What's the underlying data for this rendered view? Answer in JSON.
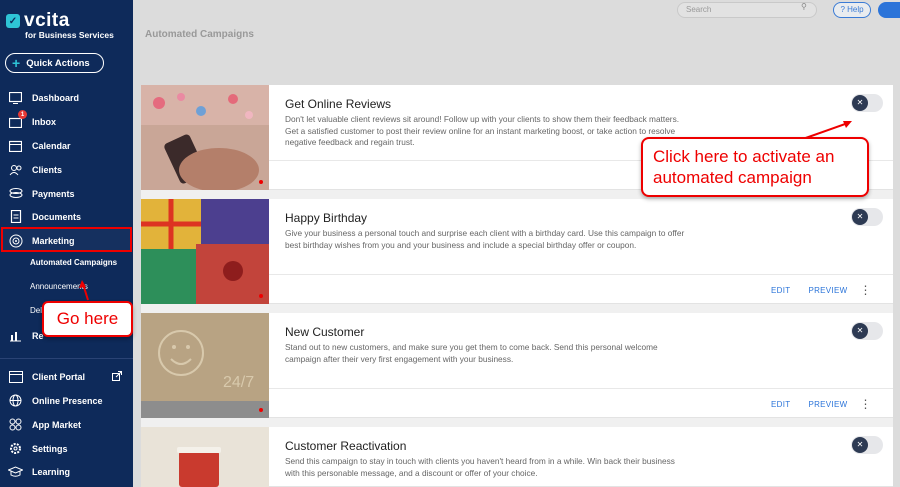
{
  "brand": {
    "name": "vcita",
    "tagline": "for Business Services"
  },
  "quick_actions": "Quick Actions",
  "sidebar": {
    "items": [
      {
        "label": "Dashboard",
        "icon": "dashboard-icon"
      },
      {
        "label": "Inbox",
        "icon": "inbox-icon",
        "badge": "1"
      },
      {
        "label": "Calendar",
        "icon": "calendar-icon"
      },
      {
        "label": "Clients",
        "icon": "clients-icon"
      },
      {
        "label": "Payments",
        "icon": "payments-icon"
      },
      {
        "label": "Documents",
        "icon": "documents-icon"
      },
      {
        "label": "Marketing",
        "icon": "marketing-icon"
      }
    ],
    "sub_items": [
      "Automated Campaigns",
      "Announcements",
      "Del"
    ],
    "reports_partial": "Re",
    "bottom_items": [
      {
        "label": "Client Portal",
        "icon": "client-portal-icon"
      },
      {
        "label": "Online Presence",
        "icon": "online-presence-icon"
      },
      {
        "label": "App Market",
        "icon": "app-market-icon"
      },
      {
        "label": "Settings",
        "icon": "settings-icon"
      },
      {
        "label": "Learning",
        "icon": "learning-icon"
      }
    ]
  },
  "topbar": {
    "search_placeholder": "Search",
    "help": "Help"
  },
  "page_title": "Automated Campaigns",
  "campaigns": [
    {
      "title": "Get Online Reviews",
      "description": "Don't let valuable client reviews sit around! Follow up with your clients to show them their feedback matters. Get a satisfied customer to post their review online for an instant marketing boost, or take action to resolve negative feedback and regain trust."
    },
    {
      "title": "Happy Birthday",
      "description": "Give your business a personal touch and surprise each client with a birthday card. Use this campaign to offer best birthday wishes from you and your business and include a special birthday offer or coupon.",
      "edit": "EDIT",
      "preview": "PREVIEW"
    },
    {
      "title": "New Customer",
      "description": "Stand out to new customers, and make sure you get them to come back. Send this personal welcome campaign after their very first engagement with your business.",
      "edit": "EDIT",
      "preview": "PREVIEW"
    },
    {
      "title": "Customer Reactivation",
      "description": "Send this campaign to stay in touch with clients you haven't heard from in a while. Win back their business with this personable message, and a discount or offer of your choice."
    }
  ],
  "callouts": {
    "activate": "Click here to activate an automated campaign",
    "go_here": "Go here"
  },
  "colors": {
    "sidebar": "#0e2a5a",
    "accent": "#2b74d9",
    "callout": "#e00000"
  }
}
